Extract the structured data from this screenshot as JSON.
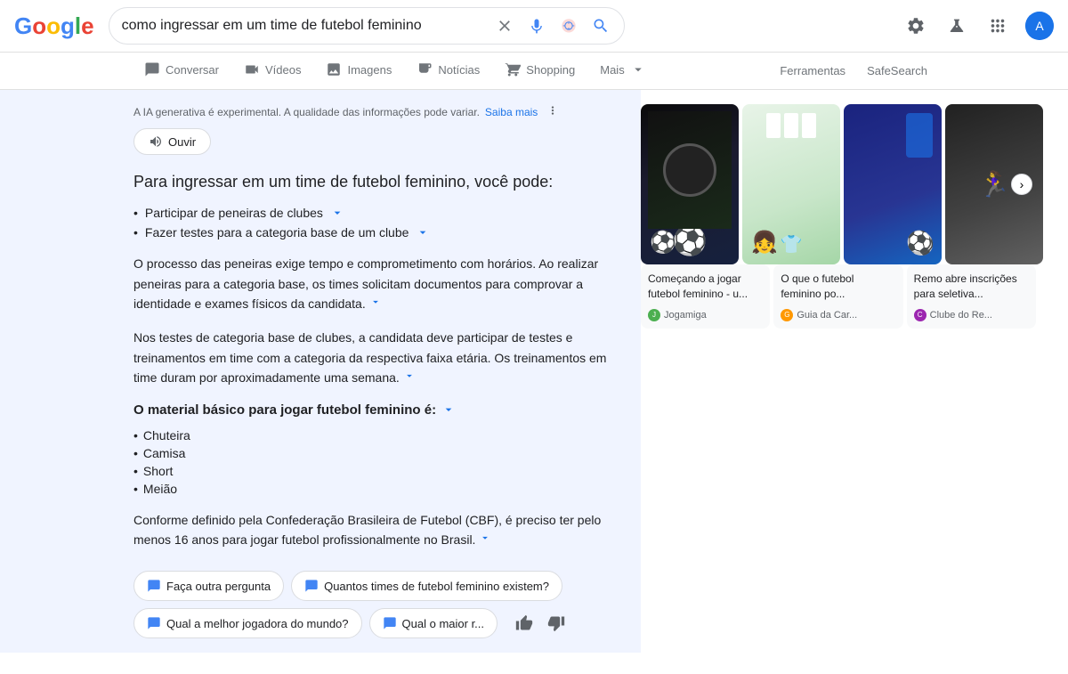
{
  "header": {
    "search_value": "como ingressar em um time de futebol feminino",
    "clear_label": "Limpar",
    "voice_label": "Pesquisa por voz",
    "lens_label": "Pesquisa por imagem",
    "search_label": "Pesquisa Google",
    "settings_label": "Configurações",
    "labs_label": "Labs",
    "apps_label": "Aplicativos Google",
    "profile_initial": "A"
  },
  "nav": {
    "tabs": [
      {
        "id": "conversar",
        "label": "Conversar",
        "active": false
      },
      {
        "id": "videos",
        "label": "Vídeos",
        "active": false
      },
      {
        "id": "imagens",
        "label": "Imagens",
        "active": false
      },
      {
        "id": "noticias",
        "label": "Notícias",
        "active": false
      },
      {
        "id": "shopping",
        "label": "Shopping",
        "active": false
      },
      {
        "id": "mais",
        "label": "Mais",
        "active": false
      },
      {
        "id": "ferramentas",
        "label": "Ferramentas",
        "active": false
      }
    ],
    "right_links": [
      "Ferramentas",
      "SafeSearch"
    ]
  },
  "ai_panel": {
    "notice_text": "A IA generativa é experimental. A qualidade das informações pode variar.",
    "notice_link": "Saiba mais",
    "ouvir_label": "Ouvir",
    "title": "Para ingressar em um time de futebol feminino, você pode:",
    "list_items": [
      "Participar de peneiras de clubes",
      "Fazer testes para a categoria base de um clube"
    ],
    "paragraphs": [
      "O processo das peneiras exige tempo e comprometimento com horários. Ao realizar peneiras para a categoria base, os times solicitam documentos para comprovar a identidade e exames físicos da candidata.",
      "Nos testes de categoria base de clubes, a candidata deve participar de testes e treinamentos em time com a categoria da respectiva faixa etária. Os treinamentos em time duram por aproximadamente uma semana."
    ],
    "subheading": "O material básico para jogar futebol feminino é:",
    "material_list": [
      "Chuteira",
      "Camisa",
      "Short",
      "Meião"
    ],
    "paragraph2": "Conforme definido pela Confederação Brasileira de Futebol (CBF), é preciso ter pelo menos 16 anos para jogar futebol profissionalmente no Brasil.",
    "suggestions": [
      "Faça outra pergunta",
      "Quantos times de futebol feminino existem?",
      "Qual a melhor jogadora do mundo?",
      "Qual o maior r..."
    ]
  },
  "right_panel": {
    "images": [
      {
        "alt": "Futebol feminino - bola",
        "color": "img1"
      },
      {
        "alt": "Futebol feminino - time",
        "color": "img2"
      },
      {
        "alt": "Futebol feminino - jogadora",
        "color": "img3"
      },
      {
        "alt": "Futebol feminino - treino",
        "color": "img4"
      }
    ],
    "source_cards": [
      {
        "title": "Começando a jogar futebol feminino - u...",
        "source": "Jogamiga",
        "icon_class": "icon-jogamiga"
      },
      {
        "title": "O que o futebol feminino po...",
        "source": "Guia da Car...",
        "icon_class": "icon-guia"
      },
      {
        "title": "Remo abre inscrições para seletiva...",
        "source": "Clube do Re...",
        "icon_class": "icon-clube"
      }
    ]
  }
}
